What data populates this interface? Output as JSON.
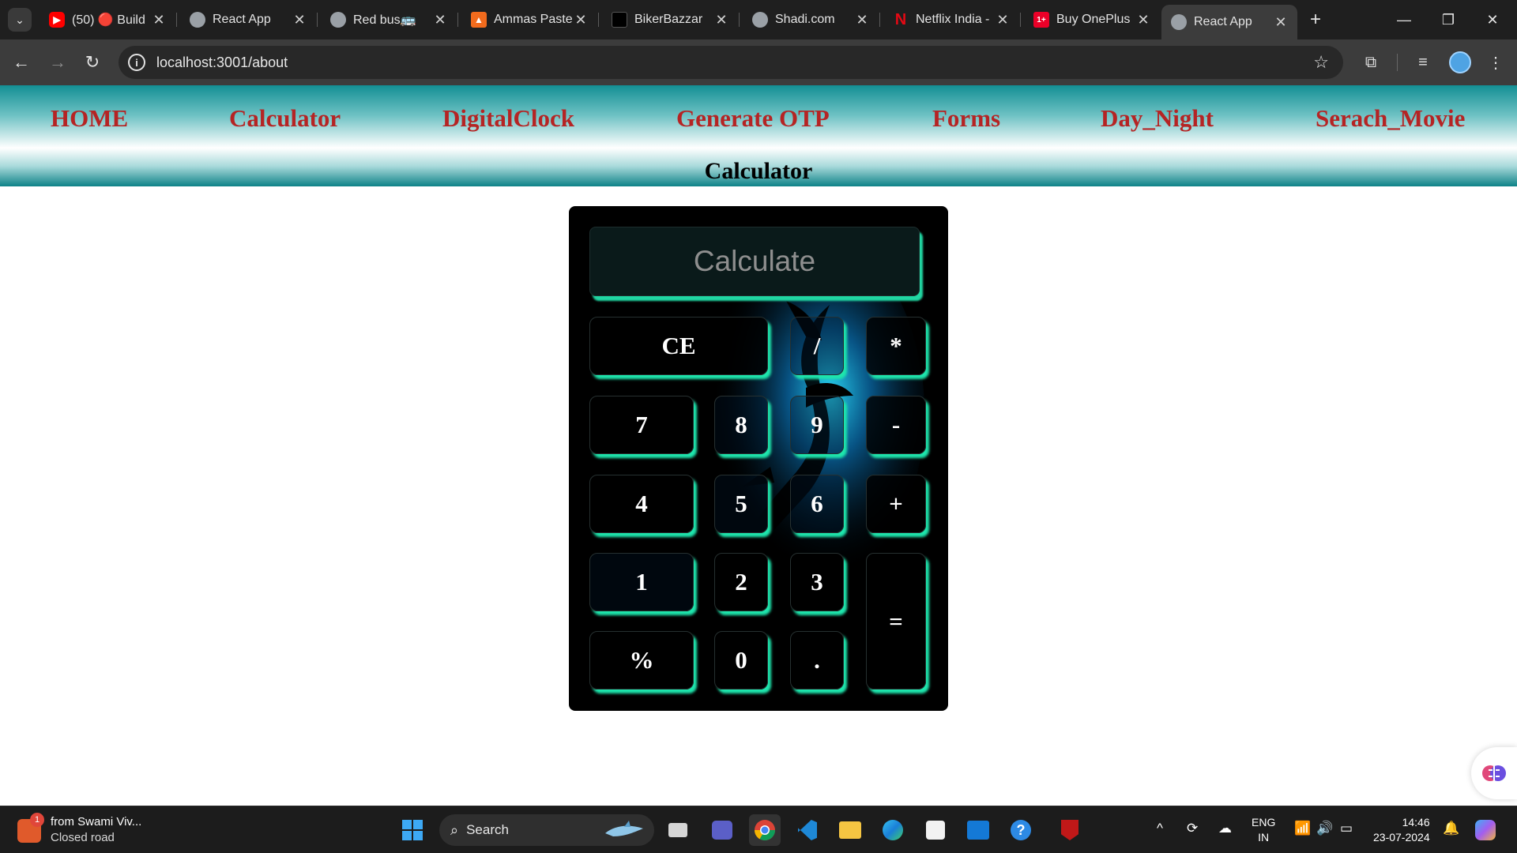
{
  "browser": {
    "tabs": [
      {
        "title": "(50) 🔴 Build",
        "icon": "youtube-icon",
        "color": "#ff0000"
      },
      {
        "title": "React App",
        "icon": "globe-icon",
        "color": "#9aa0a6"
      },
      {
        "title": "Red bus🚌",
        "icon": "globe-icon",
        "color": "#9aa0a6"
      },
      {
        "title": "Ammas Paste",
        "icon": "ammas-logo-icon",
        "color": "#f26b1d"
      },
      {
        "title": "BikerBazzar",
        "icon": "bikerbazzar-logo-icon",
        "color": "#000000"
      },
      {
        "title": "Shadi.com",
        "icon": "globe-icon",
        "color": "#9aa0a6"
      },
      {
        "title": "Netflix India -",
        "icon": "netflix-icon",
        "color": "#e50914"
      },
      {
        "title": "Buy OnePlus",
        "icon": "oneplus-icon",
        "color": "#eb0028"
      },
      {
        "title": "React App",
        "icon": "globe-icon",
        "color": "#9aa0a6",
        "active": true
      }
    ],
    "url": "localhost:3001/about"
  },
  "nav": {
    "links": [
      "HOME",
      "Calculator",
      "DigitalClock",
      "Generate OTP",
      "Forms",
      "Day_Night",
      "Serach_Movie"
    ],
    "link_color": "#b52424"
  },
  "page": {
    "heading": "Calculator"
  },
  "calculator": {
    "display_placeholder": "Calculate",
    "accent_color": "#1ee6ad",
    "keys": {
      "ce": "CE",
      "divide": "/",
      "multiply": "*",
      "seven": "7",
      "eight": "8",
      "nine": "9",
      "minus": "-",
      "four": "4",
      "five": "5",
      "six": "6",
      "plus": "+",
      "one": "1",
      "two": "2",
      "three": "3",
      "equals": "=",
      "percent": "%",
      "zero": "0",
      "dot": "."
    }
  },
  "taskbar": {
    "weather_title": "from Swami Viv...",
    "weather_sub": "Closed road",
    "notification_count": "1",
    "search_label": "Search",
    "lang_line1": "ENG",
    "lang_line2": "IN",
    "time": "14:46",
    "date": "23-07-2024"
  }
}
